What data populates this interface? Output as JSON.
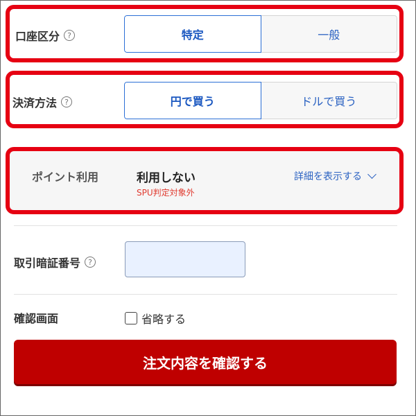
{
  "account": {
    "label": "口座区分",
    "help": "?",
    "options": [
      "特定",
      "一般"
    ],
    "selected": "特定"
  },
  "payment": {
    "label": "決済方法",
    "help": "?",
    "options": [
      "円で買う",
      "ドルで買う"
    ],
    "selected": "円で買う"
  },
  "points": {
    "label": "ポイント利用",
    "value": "利用しない",
    "note": "SPU判定対象外",
    "detail_link": "詳細を表示する"
  },
  "pin": {
    "label": "取引暗証番号",
    "help": "?",
    "value": ""
  },
  "confirm_screen": {
    "label": "確認画面",
    "checkbox_label": "省略する",
    "checked": false
  },
  "submit": {
    "label": "注文内容を確認する"
  },
  "colors": {
    "highlight": "#e60012",
    "primary_button": "#bf0000",
    "link": "#2b62c2"
  }
}
